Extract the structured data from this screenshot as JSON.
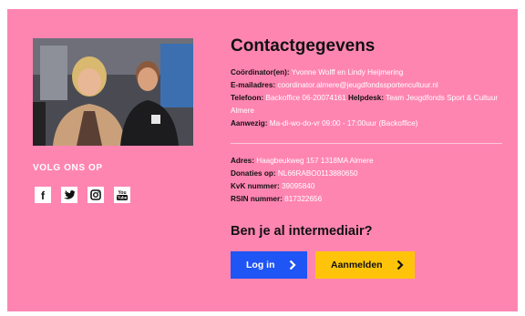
{
  "left": {
    "follow_title": "VOLG ONS OP",
    "socials": [
      {
        "icon": "facebook-icon",
        "glyph": "f"
      },
      {
        "icon": "twitter-icon",
        "glyph": "twitter"
      },
      {
        "icon": "instagram-icon",
        "glyph": "instagram"
      },
      {
        "icon": "youtube-icon",
        "glyph": "You Tube"
      }
    ]
  },
  "contact": {
    "title": "Contactgegevens",
    "coordinator_label": "Coördinator(en):",
    "coordinator_value": " Yvonne Wolff en Lindy Heijmering",
    "email_label": "E-mailadres:",
    "email_value": " coordinator.almere@jeugdfondssportencultuur.nl",
    "phone_label": "Telefoon:",
    "phone_value": " Backoffice 06-20074161",
    "helpdesk_label": "Helpdesk:",
    "helpdesk_value": " Team Jeugdfonds Sport & Cultuur Almere",
    "present_label": "Aanwezig:",
    "present_value": " Ma-di-wo-do-vr 09:00 - 17:00uur (Backoffice)",
    "address_label": "Adres:",
    "address_value": " Haagbeukweg 157 1318MA Almere",
    "donations_label": "Donaties op:",
    "donations_value": " NL66RABO0113880650",
    "kvk_label": "KvK nummer:",
    "kvk_value": " 39095840",
    "rsin_label": "RSIN nummer:",
    "rsin_value": " 817322656"
  },
  "cta": {
    "question": "Ben je al intermediair?",
    "login_label": "Log in",
    "register_label": "Aanmelden"
  },
  "colors": {
    "background": "#ff85b1",
    "login_button": "#1f54f5",
    "register_button": "#ffc40a"
  }
}
